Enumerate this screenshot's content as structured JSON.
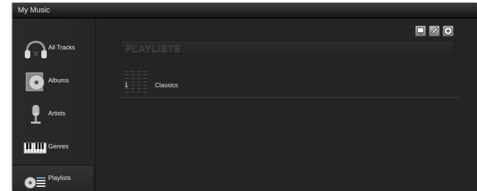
{
  "window": {
    "title": "My Music"
  },
  "sidebar": {
    "items": [
      {
        "label": "All Tracks",
        "icon": "headphones-icon"
      },
      {
        "label": "Albums",
        "icon": "album-disc-icon"
      },
      {
        "label": "Artists",
        "icon": "microphone-icon"
      },
      {
        "label": "Genres",
        "icon": "piano-keys-icon"
      },
      {
        "label": "Playlists",
        "icon": "playlist-icon",
        "active": true
      }
    ]
  },
  "toolbar": {
    "buttons": [
      "present-icon",
      "edit-pencil-icon",
      "add-icon"
    ]
  },
  "main": {
    "header": "PLAYLISTS",
    "playlists": [
      {
        "number": "1",
        "name": "Classics"
      }
    ]
  }
}
